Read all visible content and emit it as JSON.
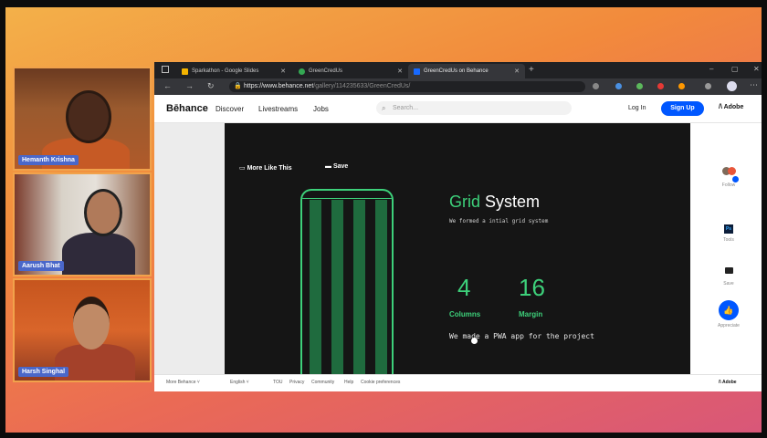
{
  "participants": [
    {
      "name": "Hemanth Krishna"
    },
    {
      "name": "Aarush Bhat"
    },
    {
      "name": "Harsh Singhal"
    }
  ],
  "browser": {
    "tabs": [
      {
        "label": "Sparkathon - Google Slides",
        "active": false
      },
      {
        "label": "GreenCredUs",
        "active": false
      },
      {
        "label": "GreenCredUs on Behance",
        "active": true
      }
    ],
    "new_tab": "+",
    "url_prefix": "https://www.behance.net",
    "url_path": "/gallery/114235633/GreenCredUs/",
    "window_controls": [
      "–",
      "▢",
      "✕"
    ]
  },
  "behance": {
    "logo": "Bēhance",
    "nav": [
      "Discover",
      "Livestreams",
      "Jobs"
    ],
    "search_placeholder": "Search...",
    "login": "Log In",
    "signup": "Sign Up",
    "adobe": "Adobe"
  },
  "project": {
    "more_like_this": "More Like This",
    "save": "Save",
    "title_green": "Grid",
    "title_white": "System",
    "subtitle": "We formed a intial grid system",
    "stats": [
      {
        "value": "4",
        "label": "Columns"
      },
      {
        "value": "16",
        "label": "Margin"
      }
    ],
    "pwa_text": "We made a PWA app for the project"
  },
  "right_sidebar": [
    {
      "label": "Follow"
    },
    {
      "label": "Tools"
    },
    {
      "label": "Save"
    },
    {
      "label": "Appreciate"
    }
  ],
  "footer": {
    "more_behance": "More Behance ˅",
    "language": "English ˅",
    "links": [
      "TOU",
      "Privacy",
      "Community",
      "Help",
      "Cookie preferences"
    ],
    "adobe": "Adobe"
  },
  "colors": {
    "accent_green": "#3dd07a",
    "behance_blue": "#0057ff",
    "name_badge": "#4a67c9"
  }
}
